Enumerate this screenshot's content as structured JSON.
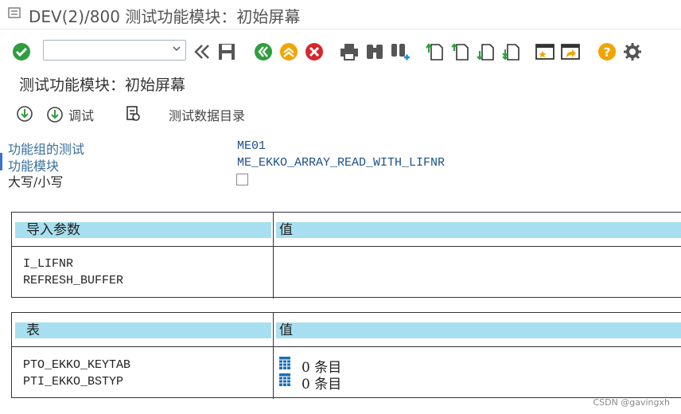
{
  "window": {
    "title": "DEV(2)/800 测试功能模块：初始屏幕"
  },
  "toolbar": {
    "command_field_value": "",
    "icons": [
      "enter-check-icon",
      "command-field",
      "back-arrows-icon",
      "save-icon",
      "back-green-icon",
      "exit-yellow-icon",
      "cancel-red-icon",
      "print-icon",
      "find-icon",
      "find-next-icon",
      "first-page-icon",
      "previous-page-icon",
      "next-page-icon",
      "last-page-icon",
      "create-session-icon",
      "shortcut-icon",
      "help-icon",
      "settings-gear-icon"
    ]
  },
  "screen": {
    "title": "测试功能模块：初始屏幕"
  },
  "app_toolbar": {
    "execute_icon": "execute-icon",
    "debug_label": "调试",
    "test_data_directory_label": "测试数据目录"
  },
  "fields": {
    "function_group_label": "功能组的测试",
    "function_group_value": "ME01",
    "function_module_label": "功能模块",
    "function_module_value": "ME_EKKO_ARRAY_READ_WITH_LIFNR",
    "uppercase_lowercase_label": "大写/小写",
    "uppercase_lowercase_checked": false
  },
  "import_params": {
    "col_param": "导入参数",
    "col_value": "值",
    "rows": [
      {
        "name": "I_LIFNR",
        "value": ""
      },
      {
        "name": "REFRESH_BUFFER",
        "value": ""
      }
    ]
  },
  "tables": {
    "col_table": "表",
    "col_value": "值",
    "rows": [
      {
        "name": "PTO_EKKO_KEYTAB",
        "count": "0",
        "unit": "条目"
      },
      {
        "name": "PTI_EKKO_BSTYP",
        "count": "0",
        "unit": "条目"
      }
    ]
  },
  "watermark": "CSDN @gavingxh",
  "colors": {
    "header_bg": "#a8dff0",
    "label_blue": "#3a6f9a",
    "value_blue": "#1c4e8a"
  }
}
